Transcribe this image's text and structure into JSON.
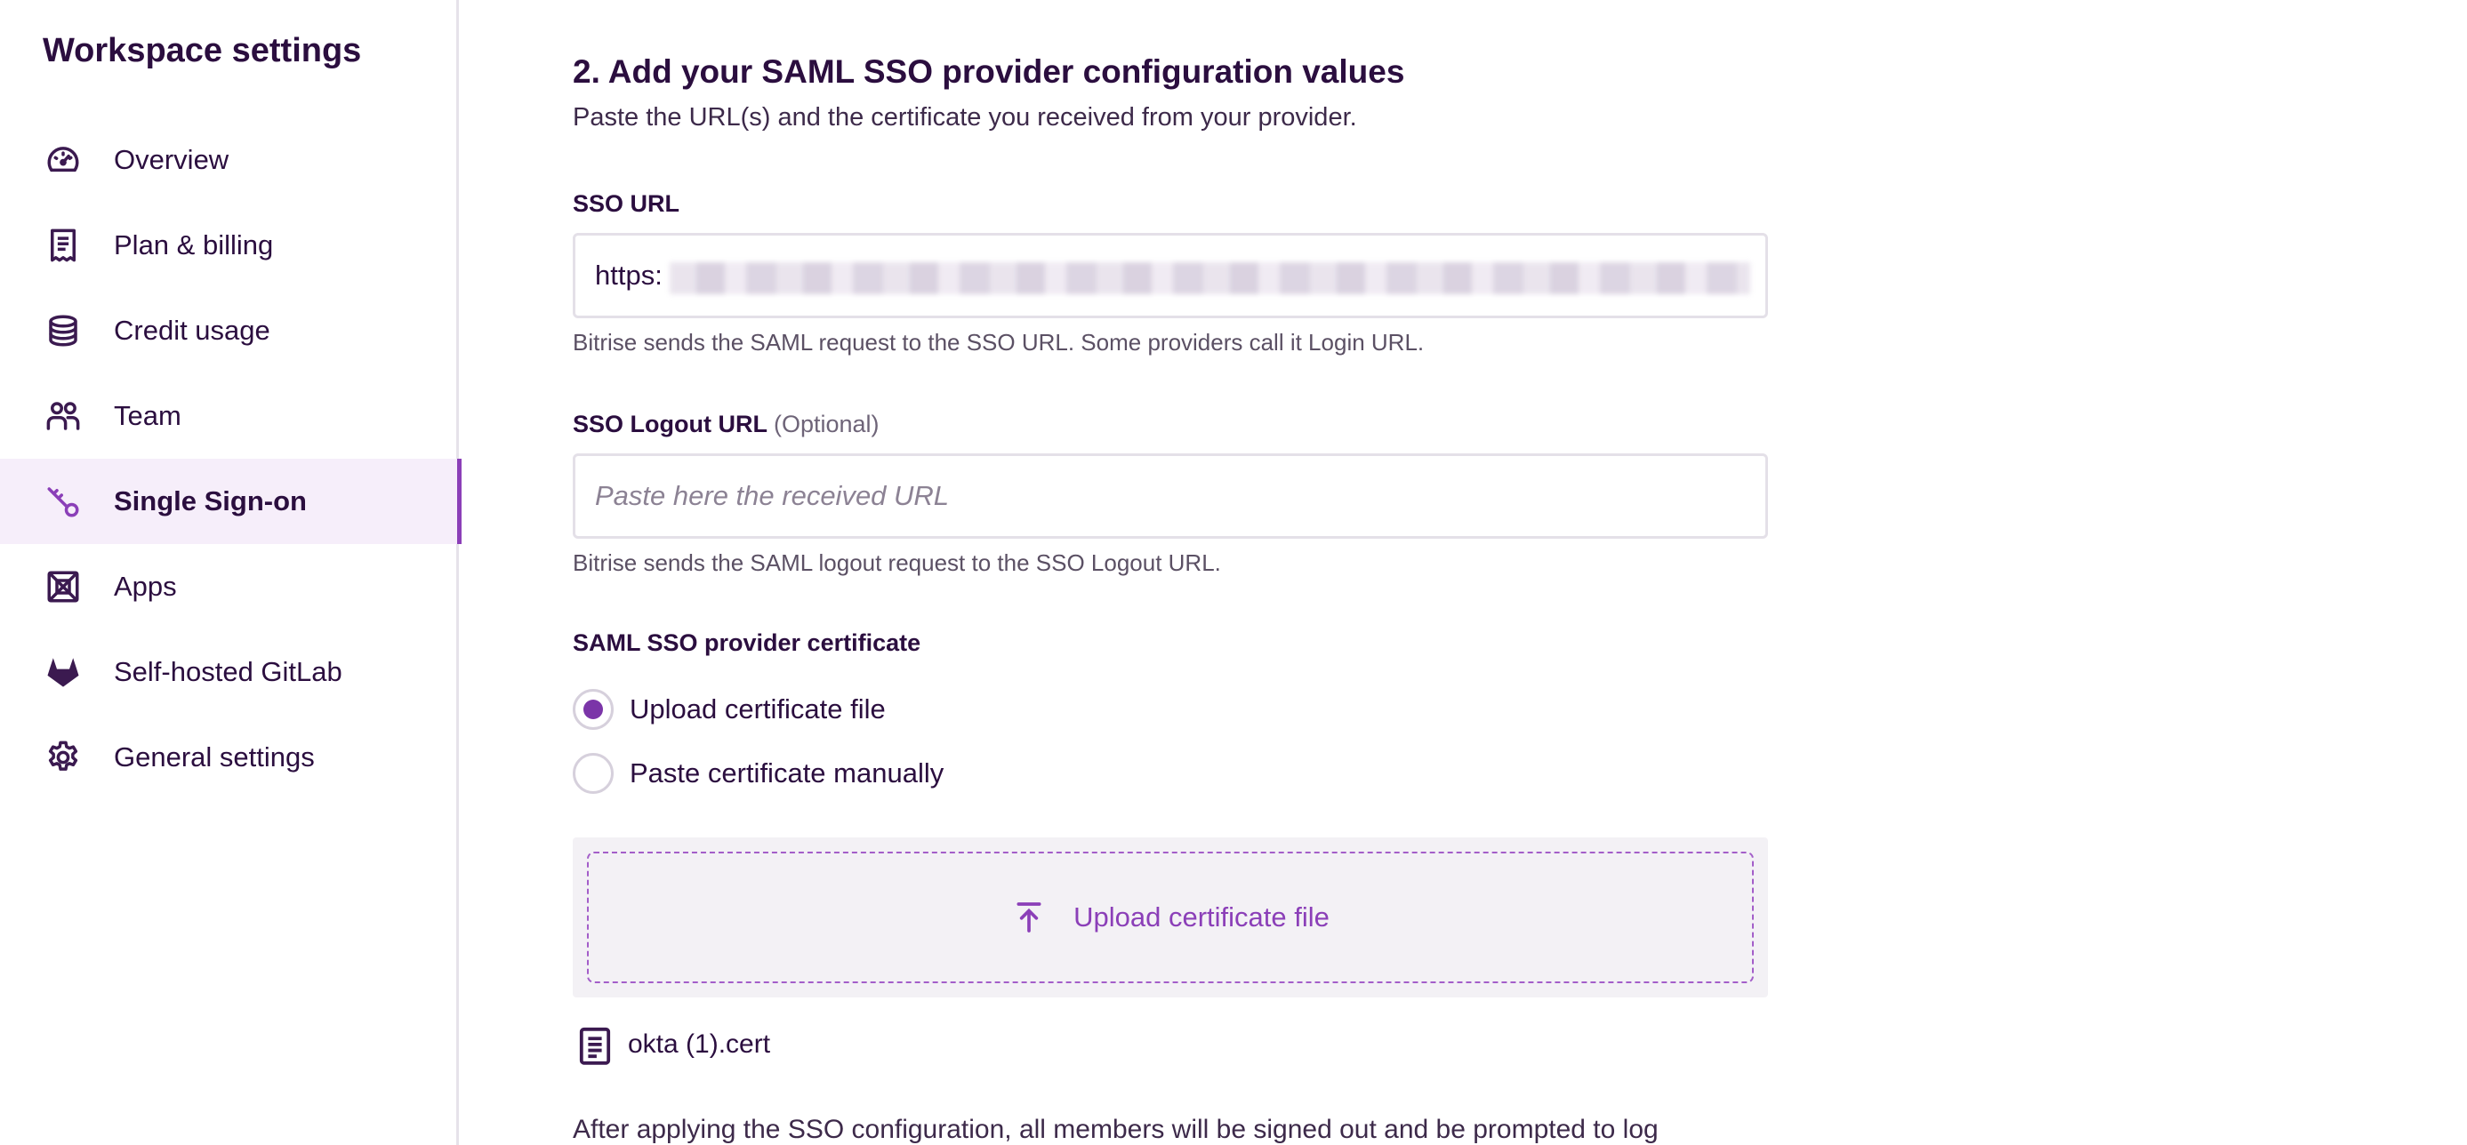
{
  "sidebar": {
    "title": "Workspace settings",
    "items": [
      {
        "label": "Overview",
        "icon": "gauge-icon"
      },
      {
        "label": "Plan & billing",
        "icon": "receipt-icon"
      },
      {
        "label": "Credit usage",
        "icon": "coins-stack-icon"
      },
      {
        "label": "Team",
        "icon": "team-icon"
      },
      {
        "label": "Single Sign-on",
        "icon": "key-icon",
        "active": true
      },
      {
        "label": "Apps",
        "icon": "apps-icon"
      },
      {
        "label": "Self-hosted GitLab",
        "icon": "gitlab-icon"
      },
      {
        "label": "General settings",
        "icon": "gear-icon"
      }
    ]
  },
  "main": {
    "heading": "2. Add your SAML SSO provider configuration values",
    "subheading": "Paste the URL(s) and the certificate you received from your provider.",
    "sso_url": {
      "label": "SSO URL",
      "value": "https:",
      "help": "Bitrise sends the SAML request to the SSO URL. Some providers call it Login URL."
    },
    "sso_logout_url": {
      "label": "SSO Logout URL",
      "optional": "(Optional)",
      "placeholder": "Paste here the received URL",
      "help": "Bitrise sends the SAML logout request to the SSO Logout URL."
    },
    "certificate": {
      "label": "SAML SSO provider certificate",
      "options": [
        {
          "label": "Upload certificate file",
          "checked": true
        },
        {
          "label": "Paste certificate manually",
          "checked": false
        }
      ],
      "upload_label": "Upload certificate file",
      "file_name": "okta (1).cert"
    },
    "footer_note": "After applying the SSO configuration, all members will be signed out and be prompted to log"
  },
  "colors": {
    "accent": "#8b3fb8",
    "text": "#2b0e3f",
    "active_bg": "#f6eefa"
  }
}
